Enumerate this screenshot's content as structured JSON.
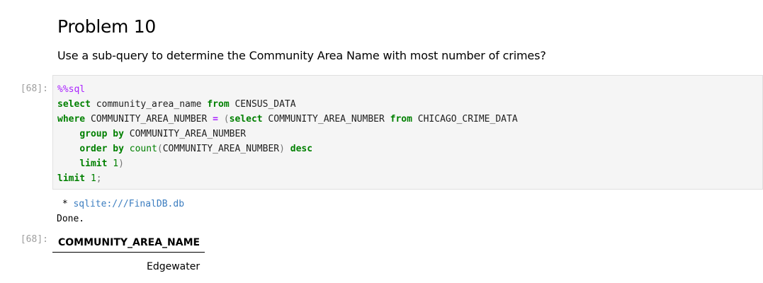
{
  "markdown": {
    "heading": "Problem 10",
    "question": "Use a sub-query to determine the Community Area Name with most number of crimes?"
  },
  "cell": {
    "input_prompt": "[68]:",
    "output_prompt": "[68]:",
    "code": {
      "line1_magic": "%%sql",
      "line2_select": "select",
      "line2_col": " community_area_name ",
      "line2_from": "from",
      "line2_table": " CENSUS_DATA",
      "line3_where": "where",
      "line3_col": " COMMUNITY_AREA_NUMBER ",
      "line3_eq": "=",
      "line3_paren": " (",
      "line3_select": "select",
      "line3_col2": " COMMUNITY_AREA_NUMBER ",
      "line3_from": "from",
      "line3_table": " CHICAGO_CRIME_DATA",
      "line4_group": "group by",
      "line4_col": " COMMUNITY_AREA_NUMBER",
      "line5_order": "order by",
      "line5_fn": "count",
      "line5_open": "(",
      "line5_col": "COMMUNITY_AREA_NUMBER",
      "line5_close": ")",
      "line5_desc": "desc",
      "line6_limit": "limit",
      "line6_num": "1",
      "line6_close": ")",
      "line7_limit": "limit",
      "line7_num": "1",
      "line7_semi": ";"
    },
    "output": {
      "connection_prefix": " * ",
      "connection": "sqlite:///FinalDB.db",
      "status": "Done."
    },
    "result": {
      "columns": [
        "COMMUNITY_AREA_NAME"
      ],
      "rows": [
        [
          "Edgewater"
        ]
      ]
    }
  }
}
